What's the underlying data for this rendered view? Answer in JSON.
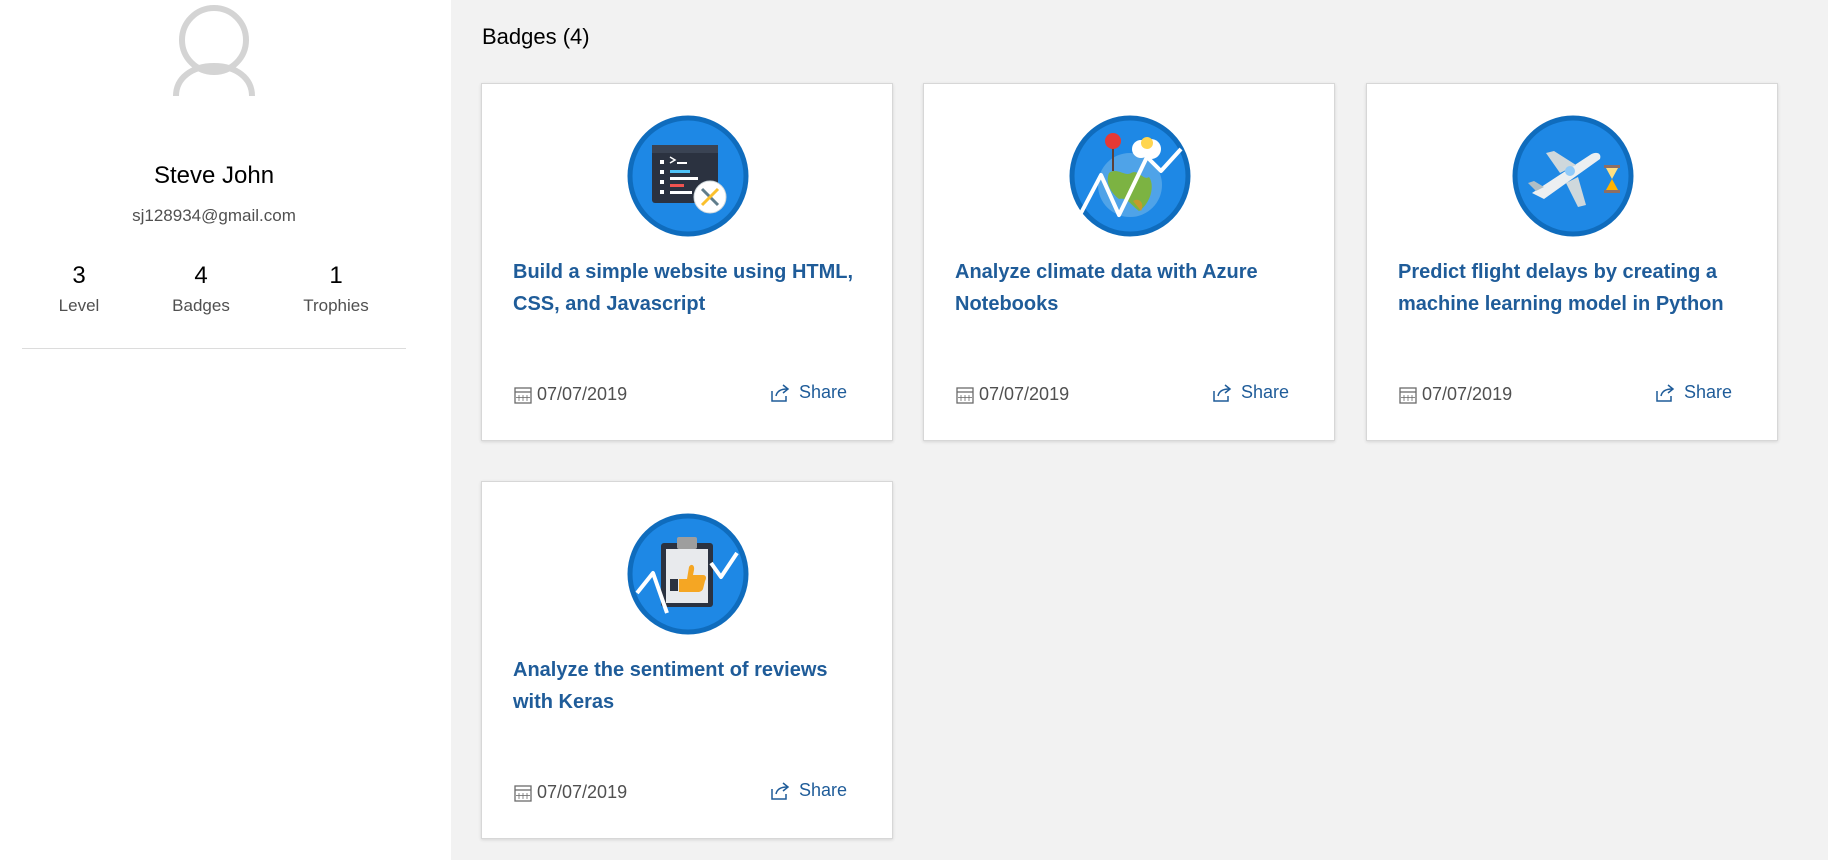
{
  "profile": {
    "name": "Steve John",
    "email": "sj128934@gmail.com",
    "avatar_icon": "user-avatar-icon",
    "stats": [
      {
        "value": "3",
        "label": "Level"
      },
      {
        "value": "4",
        "label": "Badges"
      },
      {
        "value": "1",
        "label": "Trophies"
      }
    ]
  },
  "badges_section": {
    "title": "Badges (4)",
    "share_label": "Share",
    "date_icon": "calendar-icon",
    "share_icon": "share-icon",
    "cards": [
      {
        "title": "Build a simple website using HTML, CSS, and Javascript",
        "date": "07/07/2019",
        "icon": "code-tools-icon"
      },
      {
        "title": "Analyze climate data with Azure Notebooks",
        "date": "07/07/2019",
        "icon": "climate-globe-icon"
      },
      {
        "title": "Predict flight delays by creating a machine learning model in Python",
        "date": "07/07/2019",
        "icon": "airplane-hourglass-icon"
      },
      {
        "title": "Analyze the sentiment of reviews with Keras",
        "date": "07/07/2019",
        "icon": "clipboard-thumbs-up-icon"
      }
    ]
  },
  "colors": {
    "link": "#1f5c99",
    "badge_blue": "#1e88e5",
    "badge_ring": "#0f6cbd",
    "sidebar_bg": "#ffffff",
    "main_bg": "#f2f2f2"
  }
}
